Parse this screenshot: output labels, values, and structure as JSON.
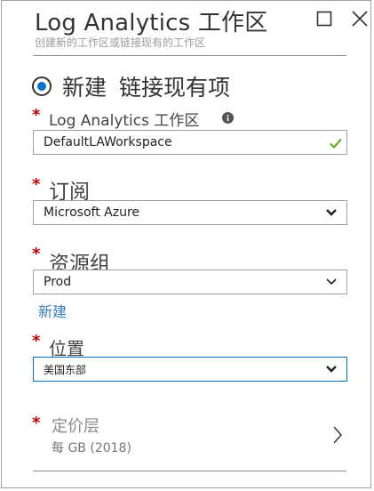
{
  "header": {
    "title": "Log Analytics 工作区",
    "subtitle": "创建新的工作区或链接现有的工作区"
  },
  "mode": {
    "option_new": "新建",
    "option_link": "链接现有项",
    "selected": "新建"
  },
  "workspace": {
    "label": "Log Analytics 工作区",
    "required_mark": "*",
    "value": "DefaultLAWorkspace"
  },
  "subscription": {
    "label": "订阅",
    "required_mark": "*",
    "value": "Microsoft Azure"
  },
  "resource_group": {
    "label": "资源组",
    "required_mark": "*",
    "value": "Prod",
    "create_link": "新建"
  },
  "location": {
    "label": "位置",
    "required_mark": "*",
    "value": "美国东部"
  },
  "pricing_tier": {
    "label": "定价层",
    "required_mark": "*",
    "value": "每 GB (2018)"
  },
  "colors": {
    "accent": "#0072c6",
    "required": "#c00000",
    "valid_check": "#5ba71b",
    "link": "#3a7fc4"
  },
  "icons": {
    "maximize": "maximize-icon",
    "close": "close-icon",
    "info": "info-icon",
    "check": "check-icon",
    "dropdown": "chevron-down-icon",
    "navigate": "chevron-right-icon"
  }
}
